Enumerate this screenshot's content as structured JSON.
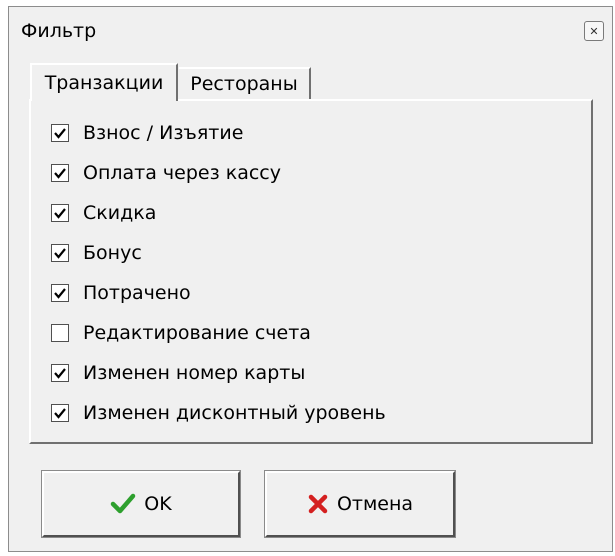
{
  "window": {
    "title": "Фильтр"
  },
  "tabs": [
    {
      "label": "Транзакции",
      "active": true
    },
    {
      "label": "Рестораны",
      "active": false
    }
  ],
  "checklist": [
    {
      "label": "Взнос / Изъятие",
      "checked": true
    },
    {
      "label": "Оплата через кассу",
      "checked": true
    },
    {
      "label": "Скидка",
      "checked": true
    },
    {
      "label": "Бонус",
      "checked": true
    },
    {
      "label": "Потрачено",
      "checked": true
    },
    {
      "label": "Редактирование счета",
      "checked": false
    },
    {
      "label": "Изменен номер карты",
      "checked": true
    },
    {
      "label": "Изменен дисконтный уровень",
      "checked": true
    }
  ],
  "buttons": {
    "ok": {
      "label": "OK",
      "icon": "checkmark-icon",
      "color": "#2ea02e"
    },
    "cancel": {
      "label": "Отмена",
      "icon": "x-icon",
      "color": "#d42020"
    }
  }
}
